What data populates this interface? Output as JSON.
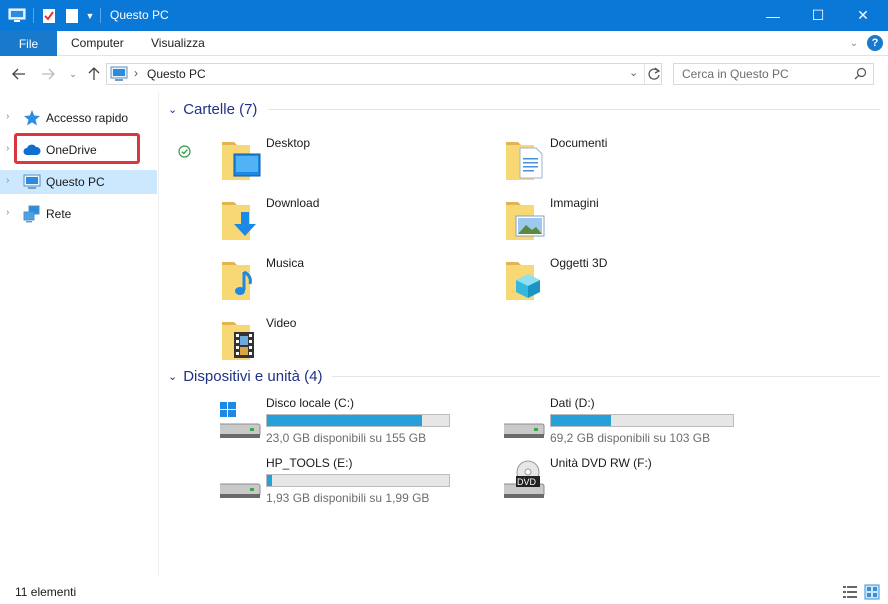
{
  "window": {
    "title": "Questo PC",
    "controls": {
      "minimize": "—",
      "maximize": "☐",
      "close": "✕"
    }
  },
  "ribbon": {
    "tabs": [
      "File",
      "Computer",
      "Visualizza"
    ],
    "help": "?"
  },
  "address": {
    "path": "Questo PC",
    "separator": "›",
    "search_placeholder": "Cerca in Questo PC"
  },
  "sidebar": {
    "items": [
      {
        "label": "Accesso rapido",
        "icon": "star-icon"
      },
      {
        "label": "OneDrive",
        "icon": "cloud-icon"
      },
      {
        "label": "Questo PC",
        "icon": "computer-icon"
      },
      {
        "label": "Rete",
        "icon": "network-icon"
      }
    ],
    "highlighted_item": "OneDrive",
    "selected_item": "Questo PC"
  },
  "folders": {
    "header": "Cartelle (7)",
    "items": [
      {
        "name": "Desktop",
        "icon": "desktop-folder-icon",
        "synced": true
      },
      {
        "name": "Documenti",
        "icon": "documents-folder-icon"
      },
      {
        "name": "Download",
        "icon": "download-folder-icon"
      },
      {
        "name": "Immagini",
        "icon": "pictures-folder-icon"
      },
      {
        "name": "Musica",
        "icon": "music-folder-icon"
      },
      {
        "name": "Oggetti 3D",
        "icon": "3d-objects-folder-icon"
      },
      {
        "name": "Video",
        "icon": "video-folder-icon"
      }
    ]
  },
  "devices": {
    "header": "Dispositivi e unità (4)",
    "items": [
      {
        "name": "Disco locale (C:)",
        "free": "23,0 GB disponibili su 155 GB",
        "used_fraction": 0.852,
        "icon": "windows-drive-icon",
        "has_bar": true
      },
      {
        "name": "Dati (D:)",
        "free": "69,2 GB disponibili su 103 GB",
        "used_fraction": 0.328,
        "icon": "drive-icon",
        "has_bar": true
      },
      {
        "name": "HP_TOOLS (E:)",
        "free": "1,93 GB disponibili su 1,99 GB",
        "used_fraction": 0.03,
        "icon": "drive-icon",
        "has_bar": true
      },
      {
        "name": "Unità DVD RW (F:)",
        "free": "",
        "icon": "dvd-drive-icon",
        "dvd_label": "DVD",
        "has_bar": false
      }
    ]
  },
  "status": {
    "count": "11 elementi"
  },
  "colors": {
    "titlebar": "#0a78d7",
    "file_tab": "#1979ca",
    "group_header": "#1e3287",
    "selected": "#cce8ff",
    "highlight": "#d9363e",
    "bar_fill": "#26a0da",
    "folder_yellow": "#f8d775"
  }
}
